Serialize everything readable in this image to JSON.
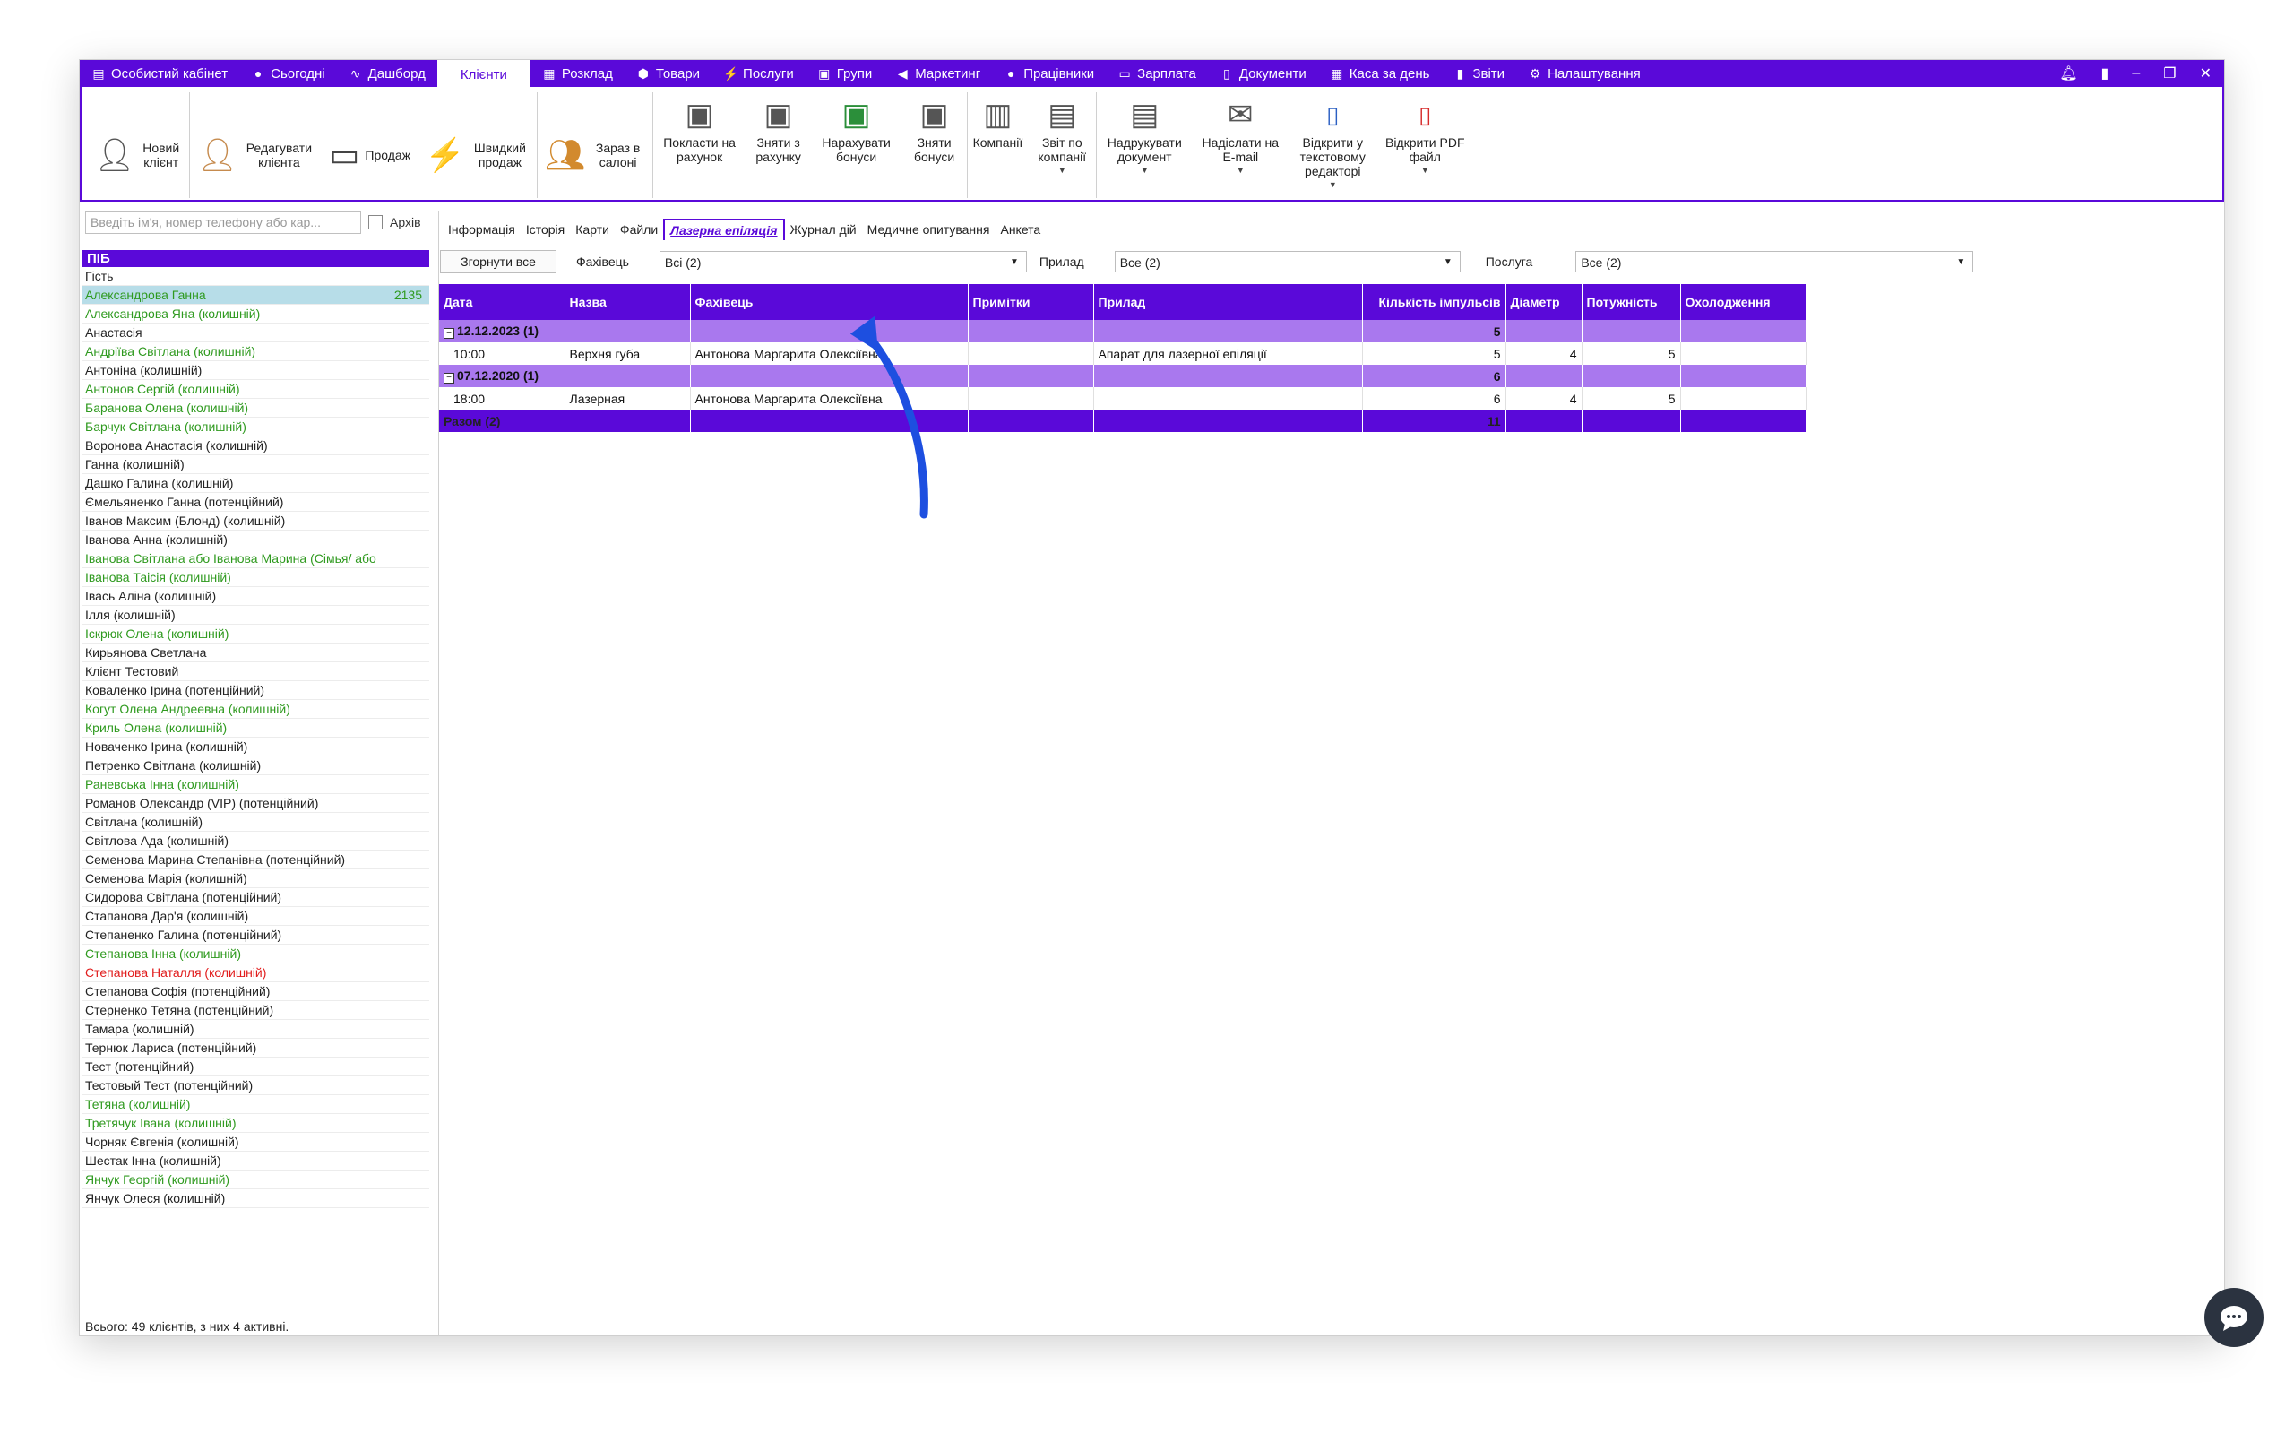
{
  "menubar": {
    "items": [
      {
        "icon": "wallet-icon",
        "glyph": "▤",
        "label": "Особистий кабінет"
      },
      {
        "icon": "today-icon",
        "glyph": "●",
        "label": "Сьогодні"
      },
      {
        "icon": "dashboard-icon",
        "glyph": "∿",
        "label": "Дашборд"
      },
      {
        "icon": "",
        "glyph": "",
        "label": "Клієнти"
      },
      {
        "icon": "calendar-icon",
        "glyph": "▦",
        "label": "Розклад"
      },
      {
        "icon": "box-icon",
        "glyph": "⬢",
        "label": "Товари"
      },
      {
        "icon": "lightning-icon",
        "glyph": "⚡",
        "label": "Послуги"
      },
      {
        "icon": "groups-icon",
        "glyph": "▣",
        "label": "Групи"
      },
      {
        "icon": "megaphone-icon",
        "glyph": "◀",
        "label": "Маркетинг"
      },
      {
        "icon": "person-icon",
        "glyph": "●",
        "label": "Працівники"
      },
      {
        "icon": "money-icon",
        "glyph": "▭",
        "label": "Зарплата"
      },
      {
        "icon": "document-icon",
        "glyph": "▯",
        "label": "Документи"
      },
      {
        "icon": "calculator-icon",
        "glyph": "▦",
        "label": "Каса за день"
      },
      {
        "icon": "bar-chart-icon",
        "glyph": "▮",
        "label": "Звіти"
      },
      {
        "icon": "gear-icon",
        "glyph": "⚙",
        "label": "Налаштування"
      }
    ]
  },
  "ribbon": {
    "new_client": "Новий клієнт",
    "edit_client": "Редагувати клієнта",
    "sale": "Продаж",
    "quick_sale": "Швидкий продаж",
    "in_salon": "Зараз в салоні",
    "deposit": "Покласти на рахунок",
    "withdraw": "Зняти з рахунку",
    "add_bonus": "Нарахувати бонуси",
    "remove_bonus": "Зняти бонуси",
    "companies": "Компанії",
    "company_report": "Звіт по компанії",
    "print_doc": "Надрукувати документ",
    "send_email": "Надіслати на E-mail",
    "open_text_editor": "Відкрити у текстовому редакторі",
    "open_pdf": "Відкрити PDF файл"
  },
  "left_panel": {
    "search_placeholder": "Введіть ім'я, номер телефону або кар...",
    "archive_label": "Архів",
    "list_header": "ПІБ",
    "footer": "Всього: 49 клієнтів, з них 4 активні.",
    "clients": [
      {
        "name": "Гість",
        "color": "black"
      },
      {
        "name": "Александрова Ганна",
        "color": "green",
        "selected": true,
        "count": "2135"
      },
      {
        "name": "Александрова Яна (колишній)",
        "color": "green"
      },
      {
        "name": "Анастасія",
        "color": "black"
      },
      {
        "name": "Андріїва Світлана (колишній)",
        "color": "green"
      },
      {
        "name": "Антоніна (колишній)",
        "color": "black"
      },
      {
        "name": "Антонов Сергій (колишній)",
        "color": "green"
      },
      {
        "name": "Баранова Олена (колишній)",
        "color": "green"
      },
      {
        "name": "Барчук Світлана (колишній)",
        "color": "green"
      },
      {
        "name": "Воронова Анастасія (колишній)",
        "color": "black"
      },
      {
        "name": "Ганна (колишній)",
        "color": "black"
      },
      {
        "name": "Дашко Галина (колишній)",
        "color": "black"
      },
      {
        "name": "Ємельяненко Ганна (потенційний)",
        "color": "black"
      },
      {
        "name": "Іванов Максим (Блонд) (колишній)",
        "color": "black"
      },
      {
        "name": "Іванова Анна (колишній)",
        "color": "black"
      },
      {
        "name": "Іванова Світлана  або Іванова  Марина (Сімья/  або",
        "color": "green"
      },
      {
        "name": "Іванова Таісія (колишній)",
        "color": "green"
      },
      {
        "name": "Івась Аліна (колишній)",
        "color": "black"
      },
      {
        "name": "Ілля (колишній)",
        "color": "black"
      },
      {
        "name": "Іскрюк Олена (колишній)",
        "color": "green"
      },
      {
        "name": "Кирьянова Светлана",
        "color": "black"
      },
      {
        "name": "Клієнт Тестовий",
        "color": "black"
      },
      {
        "name": "Коваленко Ірина (потенційний)",
        "color": "black"
      },
      {
        "name": "Когут Олена Андреевна (колишній)",
        "color": "green"
      },
      {
        "name": "Криль Олена (колишній)",
        "color": "green"
      },
      {
        "name": "Новаченко Ірина (колишній)",
        "color": "black"
      },
      {
        "name": "Петренко Світлана (колишній)",
        "color": "black"
      },
      {
        "name": "Раневська Інна (колишній)",
        "color": "green"
      },
      {
        "name": "Романов Олександр (VIP) (потенційний)",
        "color": "black"
      },
      {
        "name": "Світлана (колишній)",
        "color": "black"
      },
      {
        "name": "Світлова Ада (колишній)",
        "color": "black"
      },
      {
        "name": "Семенова Марина Степанівна (потенційний)",
        "color": "black"
      },
      {
        "name": "Семенова Марія (колишній)",
        "color": "black"
      },
      {
        "name": "Сидорова Світлана (потенційний)",
        "color": "black"
      },
      {
        "name": "Стапанова Дар'я (колишній)",
        "color": "black"
      },
      {
        "name": "Степаненко Галина (потенційний)",
        "color": "black"
      },
      {
        "name": "Степанова Інна (колишній)",
        "color": "green"
      },
      {
        "name": "Степанова Наталля (колишній)",
        "color": "red"
      },
      {
        "name": "Степанова Софія (потенційний)",
        "color": "black"
      },
      {
        "name": "Стерненко Тетяна (потенційний)",
        "color": "black"
      },
      {
        "name": "Тамара (колишній)",
        "color": "black"
      },
      {
        "name": "Тернюк Лариса (потенційний)",
        "color": "black"
      },
      {
        "name": "Тест (потенційний)",
        "color": "black"
      },
      {
        "name": "Тестовый Тест (потенційний)",
        "color": "black"
      },
      {
        "name": "Тетяна (колишній)",
        "color": "green"
      },
      {
        "name": "Третячук Івана (колишній)",
        "color": "green"
      },
      {
        "name": "Чорняк Євгенія (колишній)",
        "color": "black"
      },
      {
        "name": "Шестак Інна (колишній)",
        "color": "black"
      },
      {
        "name": "Янчук Георгій (колишній)",
        "color": "green"
      },
      {
        "name": "Янчук Олеся (колишній)",
        "color": "black"
      }
    ]
  },
  "tabs": [
    "Інформація",
    "Історія",
    "Карти",
    "Файли",
    "Лазерна епіляція",
    "Журнал дій",
    "Медичне опитування",
    "Анкета"
  ],
  "active_tab_index": 4,
  "filters": {
    "collapse_all": "Згорнути все",
    "specialist_label": "Фахівець",
    "specialist_value": "Всі (2)",
    "device_label": "Прилад",
    "device_value": "Все (2)",
    "service_label": "Послуга",
    "service_value": "Все (2)"
  },
  "grid": {
    "columns": [
      "Дата",
      "Назва",
      "Фахівець",
      "Примітки",
      "Прилад",
      "Кількість імпульсів",
      "Діаметр",
      "Потужність",
      "Охолодження"
    ],
    "groups": [
      {
        "label": "12.12.2023 (1)",
        "total": "5",
        "rows": [
          {
            "time": "10:00",
            "name": "Верхня губа",
            "specialist": "Антонова Маргарита Олексіївна",
            "notes": "",
            "device": "Апарат для лазерної епіляції",
            "pulses": "5",
            "diameter": "4",
            "power": "5",
            "cooling": ""
          }
        ]
      },
      {
        "label": "07.12.2020 (1)",
        "total": "6",
        "rows": [
          {
            "time": "18:00",
            "name": "Лазерная",
            "specialist": "Антонова Маргарита Олексіївна",
            "notes": "",
            "device": "",
            "pulses": "6",
            "diameter": "4",
            "power": "5",
            "cooling": ""
          }
        ]
      }
    ],
    "total_label": "Разом (2)",
    "total_value": "11"
  },
  "colors": {
    "accent": "#5a09d9",
    "group_row": "#a978ee",
    "selected_row": "#b7dde8",
    "green_text": "#2f9a1f",
    "red_text": "#e11c1c",
    "annotation_arrow": "#1d4fe0"
  }
}
